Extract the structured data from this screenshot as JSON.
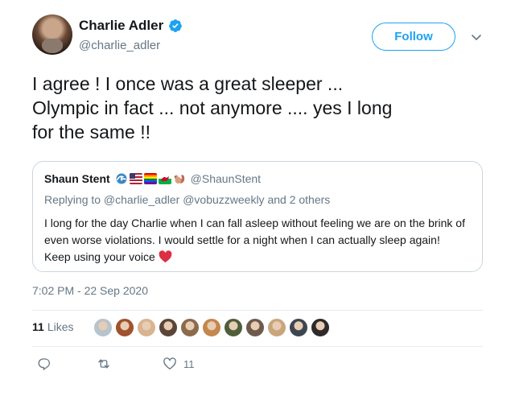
{
  "author": {
    "name": "Charlie Adler",
    "handle": "@charlie_adler",
    "verified_icon": "verified-badge-icon"
  },
  "follow_label": "Follow",
  "tweet": {
    "lines": [
      "I agree ! I once was a great sleeper ...",
      "Olympic in fact ... not anymore .... yes I long",
      "for the same !!"
    ]
  },
  "quote": {
    "name": "Shaun Stent",
    "handle": "@ShaunStent",
    "emojis": [
      "wave-emoji",
      "us-flag-emoji",
      "rainbow-flag-emoji",
      "wales-flag-emoji",
      "squirrel-emoji"
    ],
    "reply_to": "Replying to @charlie_adler @vobuzzweekly and 2 others",
    "body_lines": [
      "I long for the day Charlie when I can fall asleep without feeling we are on the brink of",
      "even worse violations.  I would settle for a night when I can actually sleep again!",
      "Keep using your voice"
    ],
    "trailing_emoji": "red-heart-emoji"
  },
  "timestamp": "7:02 PM - 22 Sep 2020",
  "likes": {
    "count": "11",
    "label": "Likes",
    "liker_colors": [
      "#b8c4cc",
      "#a0522d",
      "#d9b48f",
      "#5a4636",
      "#8b6b4a",
      "#c4874c",
      "#4f5e3a",
      "#6e5a4d",
      "#c9a57c",
      "#3c4650",
      "#2e2a2a"
    ]
  },
  "actions": {
    "reply_icon": "reply-icon",
    "retweet_icon": "retweet-icon",
    "like_icon": "heart-icon",
    "like_count": "11"
  },
  "colors": {
    "accent": "#1da1f2",
    "secondary_text": "#657786",
    "heart": "#e0245e"
  }
}
